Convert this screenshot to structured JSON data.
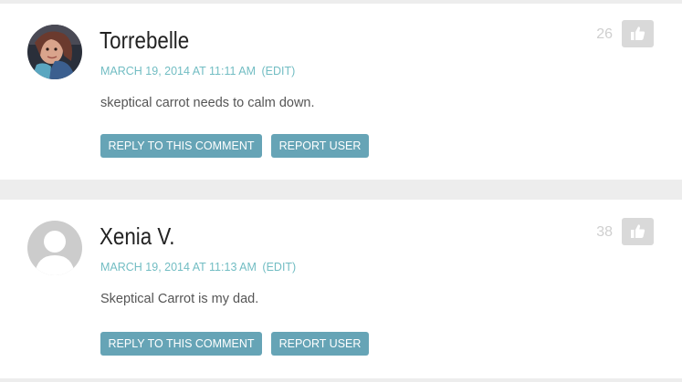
{
  "comments": [
    {
      "author": "Torrebelle",
      "date": "MARCH 19, 2014 AT 11:11 AM",
      "edit_label": "(EDIT)",
      "text": "skeptical carrot needs to calm down.",
      "reply_label": "REPLY TO THIS COMMENT",
      "report_label": "REPORT USER",
      "score": "26",
      "avatar": "user-photo-icon"
    },
    {
      "author": "Xenia V.",
      "date": "MARCH 19, 2014 AT 11:13 AM",
      "edit_label": "(EDIT)",
      "text": "Skeptical Carrot is my dad.",
      "reply_label": "REPLY TO THIS COMMENT",
      "report_label": "REPORT USER",
      "score": "38",
      "avatar": "default-avatar-icon"
    }
  ],
  "colors": {
    "accent": "#72bdc3",
    "button": "#66a4b6",
    "like_button": "#d9d9d9",
    "background": "#ededed"
  }
}
